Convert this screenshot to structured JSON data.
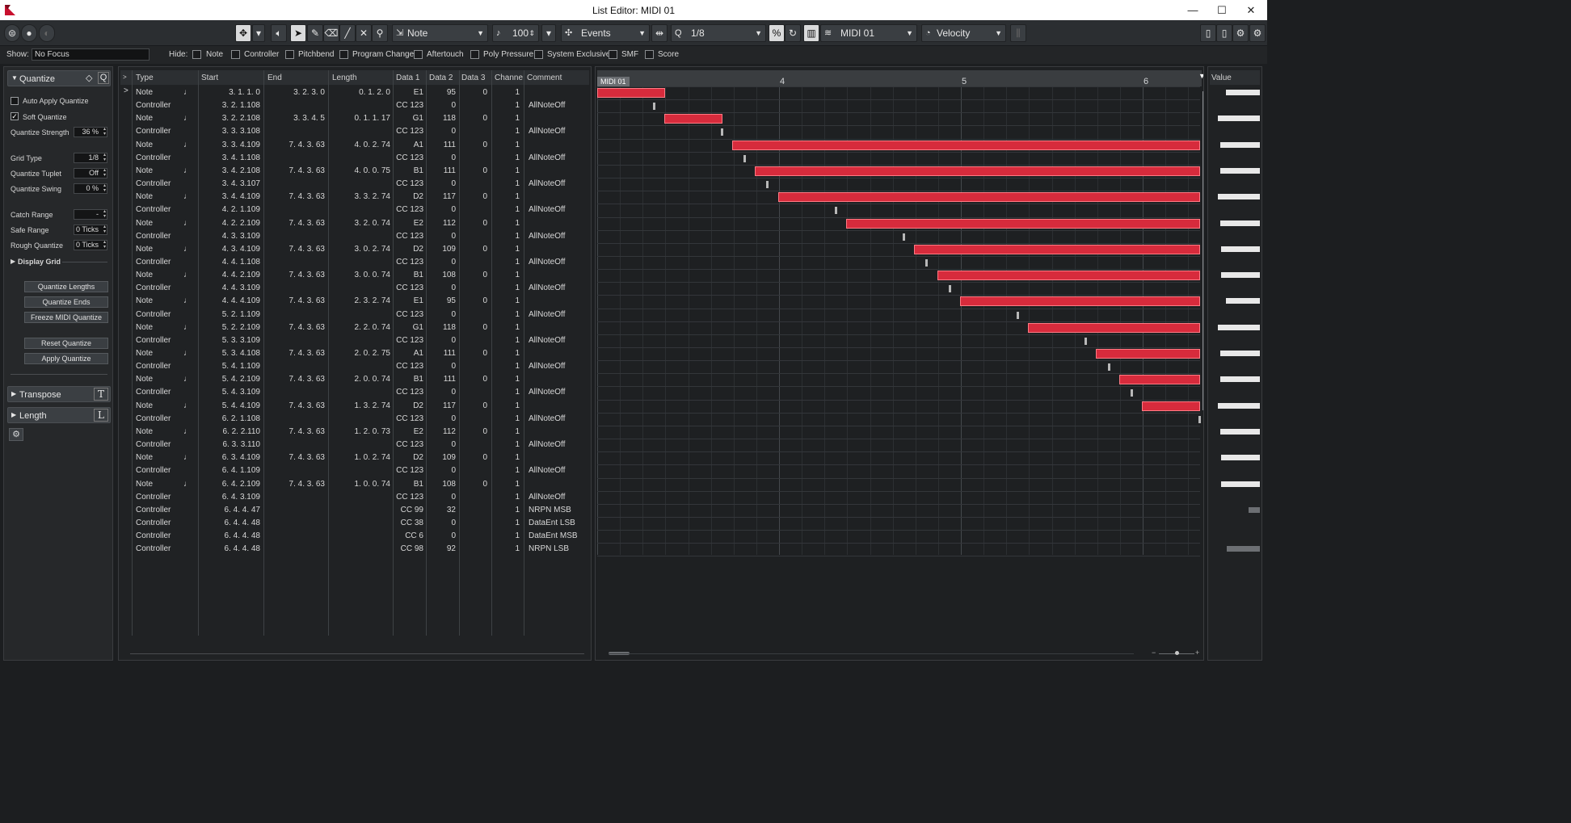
{
  "window": {
    "title": "List Editor: MIDI 01",
    "buttons": [
      "—",
      "☐",
      "✕"
    ]
  },
  "toolbar": {
    "event_type": "Note",
    "velocity_value": "100",
    "view_mode": "Events",
    "quantize": "1/8",
    "track": "MIDI 01",
    "value_display": "Velocity"
  },
  "filter": {
    "show_label": "Show:",
    "show_value": "No Focus",
    "hide_label": "Hide:",
    "items": [
      "Note",
      "Controller",
      "Pitchbend",
      "Program Change",
      "Aftertouch",
      "Poly Pressure",
      "System Exclusive",
      "SMF",
      "Score"
    ]
  },
  "inspector": {
    "quantize_title": "Quantize",
    "auto_apply": "Auto Apply Quantize",
    "soft_quantize": "Soft Quantize",
    "strength_label": "Quantize Strength",
    "strength_value": "36 %",
    "grid_type_label": "Grid Type",
    "grid_type_value": "1/8",
    "tuplet_label": "Quantize Tuplet",
    "tuplet_value": "Off",
    "swing_label": "Quantize Swing",
    "swing_value": "0 %",
    "catch_label": "Catch Range",
    "catch_value": "-",
    "safe_label": "Safe Range",
    "safe_value": "0 Ticks",
    "rough_label": "Rough Quantize",
    "rough_value": "0 Ticks",
    "display_grid": "Display Grid",
    "btn_lengths": "Quantize Lengths",
    "btn_ends": "Quantize Ends",
    "btn_freeze": "Freeze MIDI Quantize",
    "btn_reset": "Reset Quantize",
    "btn_apply": "Apply Quantize",
    "transpose": "Transpose",
    "length": "Length",
    "transpose_key": "T",
    "length_key": "L"
  },
  "list": {
    "columns": [
      "Type",
      "Start",
      "End",
      "Length",
      "Data 1",
      "Data 2",
      "Data 3",
      "Channe",
      "Comment"
    ],
    "rows": [
      [
        "Note",
        "3. 1. 1.   0",
        "3. 2. 3.   0",
        "0. 1. 2.   0",
        "E1",
        "95",
        "0",
        "1",
        ""
      ],
      [
        "Controller",
        "3. 2. 1.108",
        "",
        "",
        "CC 123",
        "0",
        "",
        "1",
        "AllNoteOff"
      ],
      [
        "Note",
        "3. 2. 2.108",
        "3. 3. 4.   5",
        "0. 1. 1. 17",
        "G1",
        "118",
        "0",
        "1",
        ""
      ],
      [
        "Controller",
        "3. 3. 3.108",
        "",
        "",
        "CC 123",
        "0",
        "",
        "1",
        "AllNoteOff"
      ],
      [
        "Note",
        "3. 3. 4.109",
        "7. 4. 3. 63",
        "4. 0. 2. 74",
        "A1",
        "111",
        "0",
        "1",
        ""
      ],
      [
        "Controller",
        "3. 4. 1.108",
        "",
        "",
        "CC 123",
        "0",
        "",
        "1",
        "AllNoteOff"
      ],
      [
        "Note",
        "3. 4. 2.108",
        "7. 4. 3. 63",
        "4. 0. 0. 75",
        "B1",
        "111",
        "0",
        "1",
        ""
      ],
      [
        "Controller",
        "3. 4. 3.107",
        "",
        "",
        "CC 123",
        "0",
        "",
        "1",
        "AllNoteOff"
      ],
      [
        "Note",
        "3. 4. 4.109",
        "7. 4. 3. 63",
        "3. 3. 2. 74",
        "D2",
        "117",
        "0",
        "1",
        ""
      ],
      [
        "Controller",
        "4. 2. 1.109",
        "",
        "",
        "CC 123",
        "0",
        "",
        "1",
        "AllNoteOff"
      ],
      [
        "Note",
        "4. 2. 2.109",
        "7. 4. 3. 63",
        "3. 2. 0. 74",
        "E2",
        "112",
        "0",
        "1",
        ""
      ],
      [
        "Controller",
        "4. 3. 3.109",
        "",
        "",
        "CC 123",
        "0",
        "",
        "1",
        "AllNoteOff"
      ],
      [
        "Note",
        "4. 3. 4.109",
        "7. 4. 3. 63",
        "3. 0. 2. 74",
        "D2",
        "109",
        "0",
        "1",
        ""
      ],
      [
        "Controller",
        "4. 4. 1.108",
        "",
        "",
        "CC 123",
        "0",
        "",
        "1",
        "AllNoteOff"
      ],
      [
        "Note",
        "4. 4. 2.109",
        "7. 4. 3. 63",
        "3. 0. 0. 74",
        "B1",
        "108",
        "0",
        "1",
        ""
      ],
      [
        "Controller",
        "4. 4. 3.109",
        "",
        "",
        "CC 123",
        "0",
        "",
        "1",
        "AllNoteOff"
      ],
      [
        "Note",
        "4. 4. 4.109",
        "7. 4. 3. 63",
        "2. 3. 2. 74",
        "E1",
        "95",
        "0",
        "1",
        ""
      ],
      [
        "Controller",
        "5. 2. 1.109",
        "",
        "",
        "CC 123",
        "0",
        "",
        "1",
        "AllNoteOff"
      ],
      [
        "Note",
        "5. 2. 2.109",
        "7. 4. 3. 63",
        "2. 2. 0. 74",
        "G1",
        "118",
        "0",
        "1",
        ""
      ],
      [
        "Controller",
        "5. 3. 3.109",
        "",
        "",
        "CC 123",
        "0",
        "",
        "1",
        "AllNoteOff"
      ],
      [
        "Note",
        "5. 3. 4.108",
        "7. 4. 3. 63",
        "2. 0. 2. 75",
        "A1",
        "111",
        "0",
        "1",
        ""
      ],
      [
        "Controller",
        "5. 4. 1.109",
        "",
        "",
        "CC 123",
        "0",
        "",
        "1",
        "AllNoteOff"
      ],
      [
        "Note",
        "5. 4. 2.109",
        "7. 4. 3. 63",
        "2. 0. 0. 74",
        "B1",
        "111",
        "0",
        "1",
        ""
      ],
      [
        "Controller",
        "5. 4. 3.109",
        "",
        "",
        "CC 123",
        "0",
        "",
        "1",
        "AllNoteOff"
      ],
      [
        "Note",
        "5. 4. 4.109",
        "7. 4. 3. 63",
        "1. 3. 2. 74",
        "D2",
        "117",
        "0",
        "1",
        ""
      ],
      [
        "Controller",
        "6. 2. 1.108",
        "",
        "",
        "CC 123",
        "0",
        "",
        "1",
        "AllNoteOff"
      ],
      [
        "Note",
        "6. 2. 2.110",
        "7. 4. 3. 63",
        "1. 2. 0. 73",
        "E2",
        "112",
        "0",
        "1",
        ""
      ],
      [
        "Controller",
        "6. 3. 3.110",
        "",
        "",
        "CC 123",
        "0",
        "",
        "1",
        "AllNoteOff"
      ],
      [
        "Note",
        "6. 3. 4.109",
        "7. 4. 3. 63",
        "1. 0. 2. 74",
        "D2",
        "109",
        "0",
        "1",
        ""
      ],
      [
        "Controller",
        "6. 4. 1.109",
        "",
        "",
        "CC 123",
        "0",
        "",
        "1",
        "AllNoteOff"
      ],
      [
        "Note",
        "6. 4. 2.109",
        "7. 4. 3. 63",
        "1. 0. 0. 74",
        "B1",
        "108",
        "0",
        "1",
        ""
      ],
      [
        "Controller",
        "6. 4. 3.109",
        "",
        "",
        "CC 123",
        "0",
        "",
        "1",
        "AllNoteOff"
      ],
      [
        "Controller",
        "6. 4. 4. 47",
        "",
        "",
        "CC 99",
        "32",
        "",
        "1",
        "NRPN MSB"
      ],
      [
        "Controller",
        "6. 4. 4. 48",
        "",
        "",
        "CC 38",
        "0",
        "",
        "1",
        "DataEnt LSB"
      ],
      [
        "Controller",
        "6. 4. 4. 48",
        "",
        "",
        "CC 6",
        "0",
        "",
        "1",
        "DataEnt MSB"
      ],
      [
        "Controller",
        "6. 4. 4. 48",
        "",
        "",
        "CC 98",
        "92",
        "",
        "1",
        "NRPN LSB"
      ]
    ]
  },
  "grid": {
    "part_name": "MIDI 01",
    "bar_markers": [
      "4",
      "5",
      "6"
    ]
  },
  "value_pane": {
    "title": "Value"
  }
}
